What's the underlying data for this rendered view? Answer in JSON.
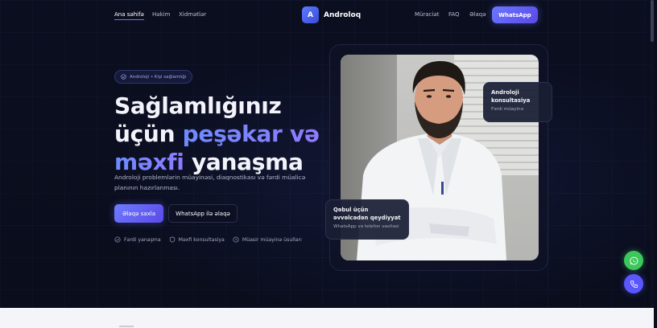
{
  "nav": {
    "links": [
      {
        "label": "Ana səhifə",
        "active": true
      },
      {
        "label": "Həkim",
        "active": false
      },
      {
        "label": "Xidmətlər",
        "active": false
      }
    ],
    "brand": {
      "logo_letter": "A",
      "name": "Androloq"
    },
    "right_links": [
      {
        "label": "Müraciət"
      },
      {
        "label": "FAQ"
      },
      {
        "label": "Əlaqə"
      }
    ],
    "cta_label": "WhatsApp"
  },
  "hero": {
    "badge": "Androloji • Kişi sağlamlığı",
    "title_line1": "Sağlamlığınız",
    "title_line2_plain": "üçün ",
    "title_line2_accent": "peşəkar və",
    "title_line3_accent": "məxfi",
    "title_line3_plain": " yanaşma",
    "description": "Androloji problemlərin müayinəsi, diaqnostikası və fərdi müalicə planının hazırlanması.",
    "primary_button": "Əlaqə saxla",
    "secondary_button": "WhatsApp ilə əlaqə",
    "features": [
      {
        "icon": "check-circle-icon",
        "label": "Fərdi yanaşma"
      },
      {
        "icon": "shield-icon",
        "label": "Məxfi konsultasiya"
      },
      {
        "icon": "clock-icon",
        "label": "Müasir müayinə üsulları"
      }
    ]
  },
  "cards": {
    "consult": {
      "title": "Androloji konsultasiya",
      "subtitle": "Fərdi müayinə"
    },
    "booking": {
      "title": "Qəbul üçün əvvəlcədən qeydiyyat",
      "subtitle": "WhatsApp və telefon vasitəsi"
    }
  },
  "fabs": {
    "whatsapp_icon": "whatsapp-icon",
    "phone_icon": "phone-icon"
  },
  "colors": {
    "accent": "#6b78ff",
    "background": "#0a0d1c",
    "whatsapp_green": "#3cc85a"
  }
}
